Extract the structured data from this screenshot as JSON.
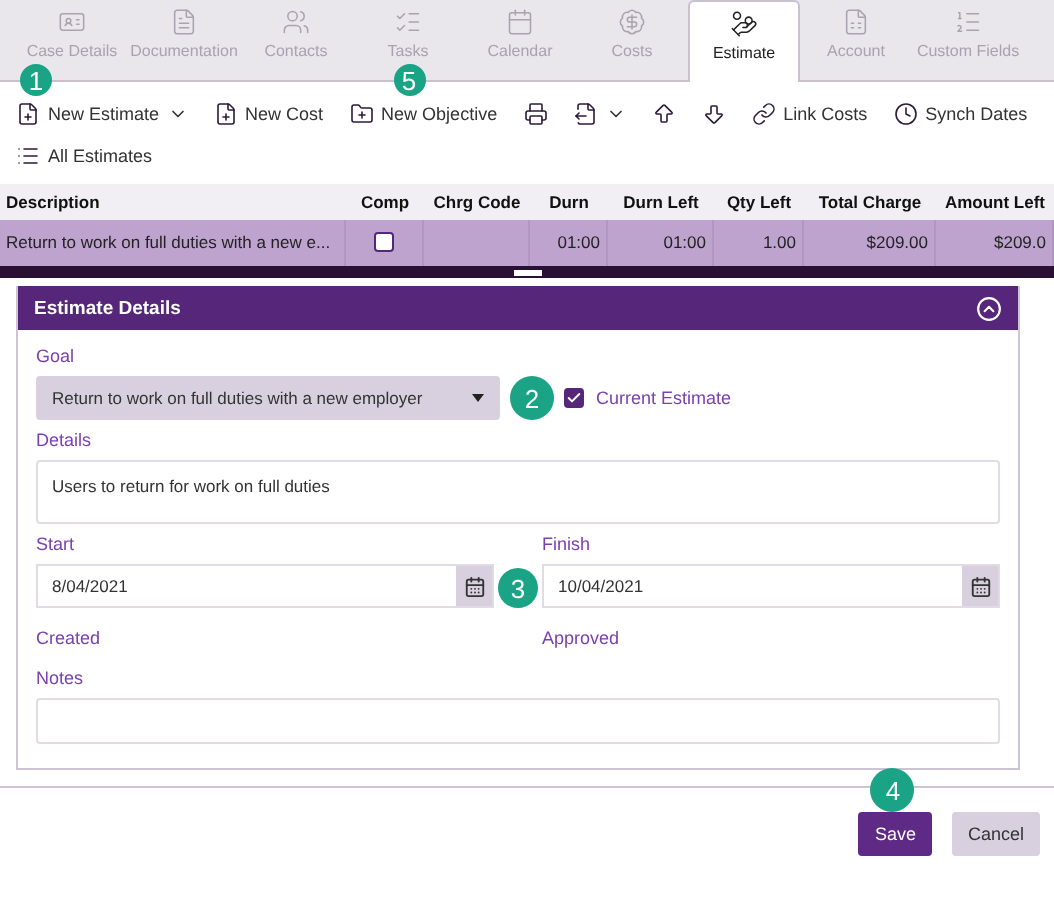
{
  "tabs": [
    {
      "label": "Case Details",
      "selected": false
    },
    {
      "label": "Documentation",
      "selected": false
    },
    {
      "label": "Contacts",
      "selected": false
    },
    {
      "label": "Tasks",
      "selected": false
    },
    {
      "label": "Calendar",
      "selected": false
    },
    {
      "label": "Costs",
      "selected": false
    },
    {
      "label": "Estimate",
      "selected": true
    },
    {
      "label": "Account",
      "selected": false
    },
    {
      "label": "Custom Fields",
      "selected": false
    }
  ],
  "toolbar": [
    {
      "label": "New Estimate",
      "dropdown": true,
      "callout": "1"
    },
    {
      "label": "New Cost",
      "dropdown": false
    },
    {
      "label": "New Objective",
      "dropdown": false,
      "callout": "5"
    },
    {
      "dropdown": false
    },
    {
      "dropdown": true
    },
    {
      "dropdown": false
    },
    {
      "dropdown": false
    },
    {
      "label": "Link Costs",
      "dropdown": false
    },
    {
      "label": "Synch Dates",
      "dropdown": false
    },
    {
      "label": "All Estimates",
      "dropdown": false
    }
  ],
  "table": {
    "columns": [
      "Description",
      "Comp",
      "Chrg Code",
      "Durn",
      "Durn Left",
      "Qty Left",
      "Total Charge",
      "Amount Left"
    ],
    "rows": [
      {
        "description": "Return to work on full duties with a new e...",
        "comp": false,
        "durn": "01:00",
        "durn_left": "01:00",
        "qty_left": "1.00",
        "total_charge": "$209.00",
        "amount_left": "$209.0",
        "selected": true
      }
    ]
  },
  "panel": {
    "title": "Estimate Details",
    "expanded": true,
    "goal_label": "Goal",
    "goal": "Return to work on full duties with a new employer",
    "goal_callout": "2",
    "current_estimate": {
      "label": "Current Estimate",
      "checked": true
    },
    "details_label": "Details",
    "details": "Users to return for work on full duties",
    "start_label": "Start",
    "start": "8/04/2021",
    "start_callout": "3",
    "finish_label": "Finish",
    "finish": "10/04/2021",
    "created_label": "Created",
    "approved_label": "Approved",
    "notes_label": "Notes"
  },
  "buttons": [
    {
      "label": "Save",
      "kind": "primary",
      "callout": "4"
    },
    {
      "label": "Cancel",
      "kind": "secondary"
    }
  ]
}
